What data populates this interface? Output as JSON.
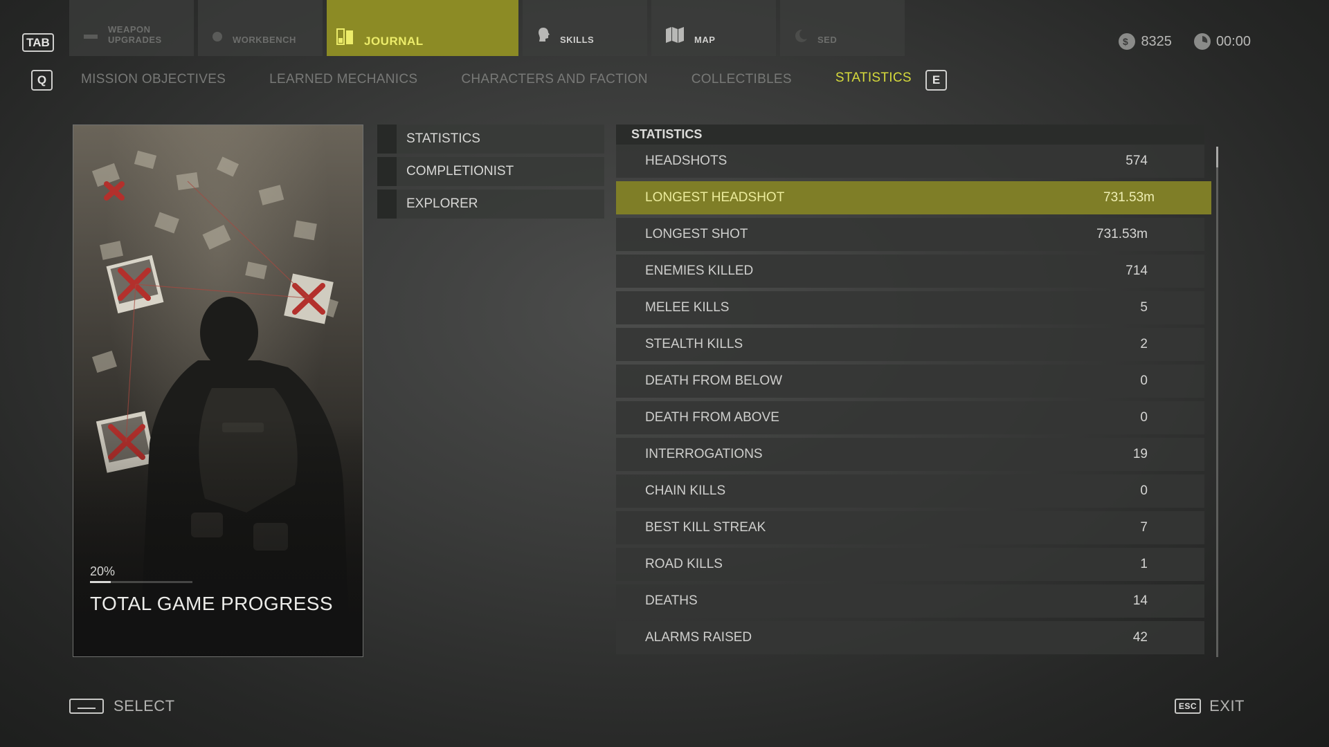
{
  "keys": {
    "tab": "TAB",
    "prev": "Q",
    "next": "E",
    "esc": "ESC"
  },
  "main_tabs": [
    {
      "label": "WEAPON UPGRADES",
      "icon": "weapon-icon",
      "state": "dim"
    },
    {
      "label": "WORKBENCH",
      "icon": "workbench-icon",
      "state": "dim"
    },
    {
      "label": "JOURNAL",
      "icon": "journal-icon",
      "state": "active"
    },
    {
      "label": "SKILLS",
      "icon": "skills-head-icon",
      "state": "normal"
    },
    {
      "label": "MAP",
      "icon": "map-icon",
      "state": "normal"
    },
    {
      "label": "SED",
      "icon": "moon-icon",
      "state": "dim"
    }
  ],
  "readouts": {
    "currency": "8325",
    "time": "00:00"
  },
  "sub_tabs": [
    "MISSION OBJECTIVES",
    "LEARNED MECHANICS",
    "CHARACTERS AND FACTION",
    "COLLECTIBLES",
    "STATISTICS"
  ],
  "active_sub_tab": "STATISTICS",
  "hero": {
    "progress_percent": "20%",
    "progress_fraction": 0.2,
    "title": "TOTAL GAME PROGRESS"
  },
  "categories": [
    "STATISTICS",
    "COMPLETIONIST",
    "EXPLORER"
  ],
  "stats": {
    "header": "STATISTICS",
    "rows": [
      {
        "label": "HEADSHOTS",
        "value": "574"
      },
      {
        "label": "LONGEST HEADSHOT",
        "value": "731.53m",
        "highlight": true
      },
      {
        "label": "LONGEST SHOT",
        "value": "731.53m"
      },
      {
        "label": "ENEMIES KILLED",
        "value": "714"
      },
      {
        "label": "MELEE KILLS",
        "value": "5"
      },
      {
        "label": "STEALTH KILLS",
        "value": "2"
      },
      {
        "label": "DEATH FROM BELOW",
        "value": "0"
      },
      {
        "label": "DEATH FROM ABOVE",
        "value": "0"
      },
      {
        "label": "INTERROGATIONS",
        "value": "19"
      },
      {
        "label": "CHAIN KILLS",
        "value": "0"
      },
      {
        "label": "BEST KILL STREAK",
        "value": "7"
      },
      {
        "label": "ROAD KILLS",
        "value": "1"
      },
      {
        "label": "DEATHS",
        "value": "14"
      },
      {
        "label": "ALARMS RAISED",
        "value": "42"
      }
    ]
  },
  "bottom": {
    "select_label": "SELECT",
    "exit_label": "EXIT"
  },
  "colors": {
    "accent": "#8c8b25",
    "accent_text": "#d6da3c",
    "highlight_row": "#7f7e27"
  }
}
